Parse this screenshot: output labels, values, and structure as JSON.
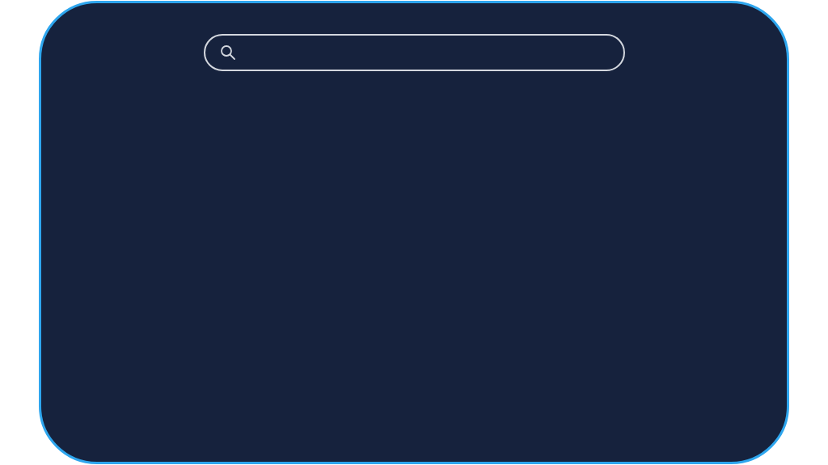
{
  "search_bar": {
    "kind": "search"
  }
}
